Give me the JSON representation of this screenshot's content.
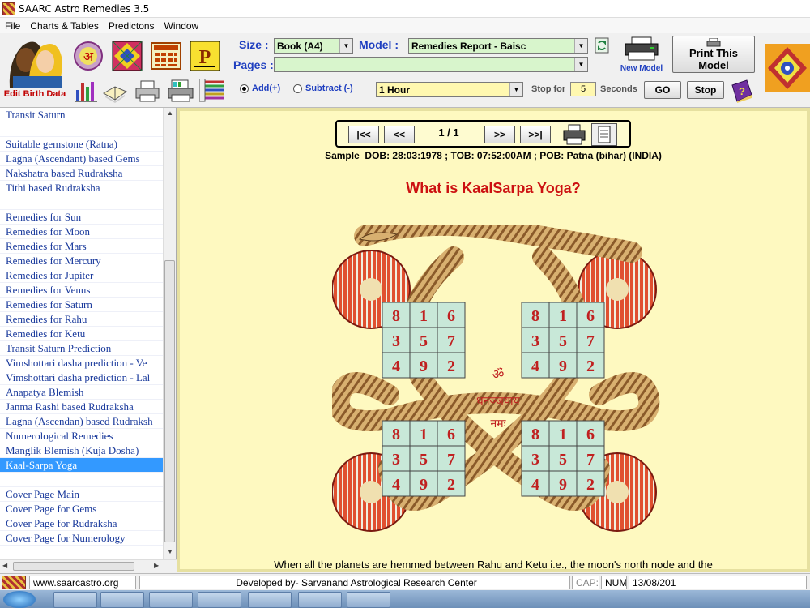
{
  "window": {
    "title": "SAARC Astro Remedies 3.5"
  },
  "menu": [
    "File",
    "Charts & Tables",
    "Predictons",
    "Window"
  ],
  "toolbar": {
    "edit_birth_label": "Edit Birth Data",
    "size_label": "Size :",
    "size_value": "Book (A4)",
    "model_label": "Model :",
    "model_value": "Remedies Report - Baisc",
    "new_model_label": "New Model",
    "print_model_label_1": "Print This",
    "print_model_label_2": "Model",
    "pages_label": "Pages :",
    "pages_value": "",
    "add_label": "Add(+)",
    "subtract_label": "Subtract (-)",
    "interval_value": "1 Hour",
    "stop_for_label": "Stop for",
    "stop_for_value": "5",
    "seconds_label": "Seconds",
    "go_label": "GO",
    "stop_label": "Stop",
    "icon_a_text": "अ",
    "icon_p_text": "P"
  },
  "sidebar": {
    "items": [
      {
        "label": "Transit Saturn"
      },
      {
        "label": ""
      },
      {
        "label": "Suitable gemstone (Ratna)"
      },
      {
        "label": "Lagna (Ascendant) based Gems"
      },
      {
        "label": "Nakshatra based Rudraksha"
      },
      {
        "label": "Tithi based Rudraksha"
      },
      {
        "label": ""
      },
      {
        "label": "Remedies for Sun"
      },
      {
        "label": "Remedies for Moon"
      },
      {
        "label": "Remedies for Mars"
      },
      {
        "label": "Remedies for Mercury"
      },
      {
        "label": "Remedies for Jupiter"
      },
      {
        "label": "Remedies for Venus"
      },
      {
        "label": "Remedies for Saturn"
      },
      {
        "label": "Remedies for Rahu"
      },
      {
        "label": "Remedies for Ketu"
      },
      {
        "label": "Transit Saturn Prediction"
      },
      {
        "label": "Vimshottari dasha prediction - Ve"
      },
      {
        "label": "Vimshottari dasha prediction - Lal"
      },
      {
        "label": "Anapatya Blemish"
      },
      {
        "label": "Janma Rashi based Rudraksha"
      },
      {
        "label": "Lagna (Ascendan) based Rudraksh"
      },
      {
        "label": "Numerological Remedies"
      },
      {
        "label": "Manglik Blemish (Kuja Dosha)"
      },
      {
        "label": "Kaal-Sarpa Yoga",
        "selected": true
      },
      {
        "label": ""
      },
      {
        "label": "Cover Page Main"
      },
      {
        "label": "Cover Page for Gems"
      },
      {
        "label": "Cover Page for Rudraksha"
      },
      {
        "label": "Cover Page for Numerology"
      }
    ]
  },
  "report": {
    "nav": {
      "first": "|<<",
      "prev": "<<",
      "page": "1 / 1",
      "next": ">>",
      "last": ">>|"
    },
    "sample_line": "Sample  DOB: 28:03:1978 ; TOB: 07:52:00AM ; POB: Patna (bihar) (INDIA)",
    "heading": "What is KaalSarpa Yoga?",
    "heading_color": "#cc1111",
    "yantra_grid": [
      [
        "8",
        "1",
        "6"
      ],
      [
        "3",
        "5",
        "7"
      ],
      [
        "4",
        "9",
        "2"
      ]
    ],
    "mantra_1": "ॐ",
    "mantra_2": "धनञ्जयाय",
    "mantra_3": "नमः",
    "body_text": "When all the planets are hemmed between Rahu and Ketu i.e., the moon's north node and the"
  },
  "statusbar": {
    "website": "www.saarcastro.org",
    "developer": "Developed by- Sarvanand Astrological Research Center",
    "caps": "CAP:",
    "num": "NUM",
    "date": "13/08/201"
  }
}
